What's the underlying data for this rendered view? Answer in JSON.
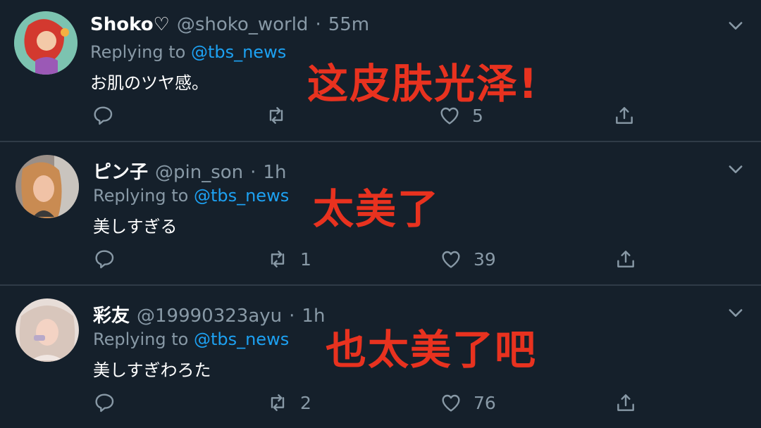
{
  "tweets": [
    {
      "name": "Shoko♡",
      "handle": "@shoko_world",
      "dot": "·",
      "time": "55m",
      "reply_prefix": "Replying to ",
      "reply_mention": "@tbs_news",
      "text": "お肌のツヤ感。",
      "caption": "这皮肤光泽!",
      "retweets": "",
      "likes": "5"
    },
    {
      "name": "ピン子",
      "handle": "@pin_son",
      "dot": "·",
      "time": "1h",
      "reply_prefix": "Replying to ",
      "reply_mention": "@tbs_news",
      "text": "美しすぎる",
      "caption": "太美了",
      "retweets": "1",
      "likes": "39"
    },
    {
      "name": "彩友",
      "handle": "@19990323ayu",
      "dot": "·",
      "time": "1h",
      "reply_prefix": "Replying to ",
      "reply_mention": "@tbs_news",
      "text": "美しすぎわろた",
      "caption": "也太美了吧",
      "retweets": "2",
      "likes": "76"
    }
  ],
  "colors": {
    "background": "#15202b",
    "secondary_text": "#8899a6",
    "mention": "#1da1f2",
    "caption": "#e8321f"
  },
  "icons": [
    "reply-icon",
    "retweet-icon",
    "like-icon",
    "share-icon",
    "chevron-down-icon"
  ]
}
